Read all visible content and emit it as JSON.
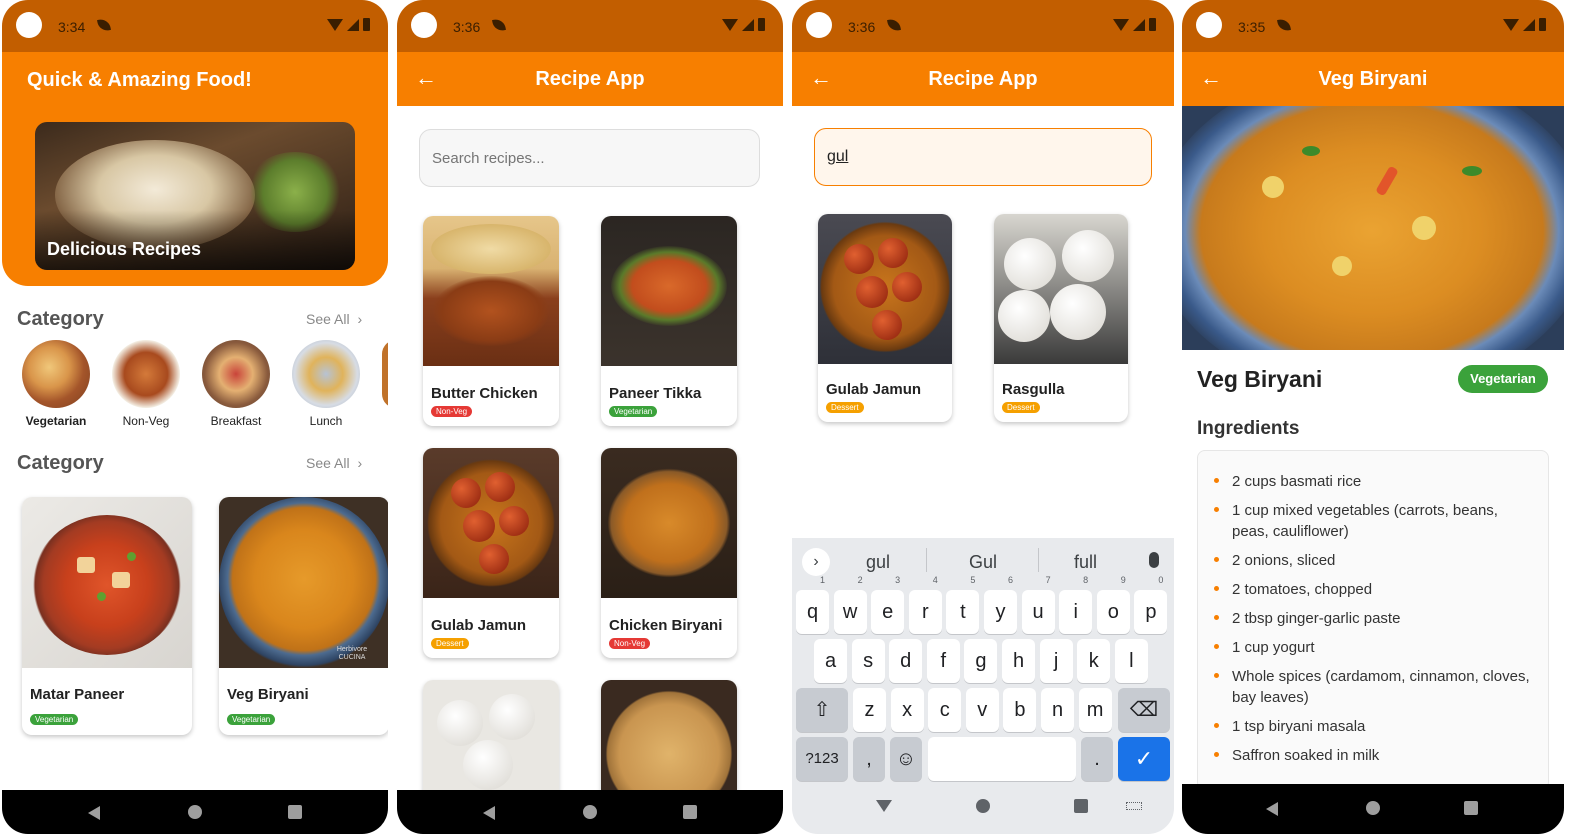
{
  "screens": [
    {
      "status_time": "3:34",
      "header_title": "Quick & Amazing Food!",
      "hero_label": "Delicious Recipes",
      "section1_title": "Category",
      "section1_see_all": "See All",
      "categories": [
        "Vegetarian",
        "Non-Veg",
        "Breakfast",
        "Lunch"
      ],
      "section2_title": "Category",
      "section2_see_all": "See All",
      "recipes": [
        {
          "name": "Matar Paneer",
          "tag": "Vegetarian"
        },
        {
          "name": "Veg Biryani",
          "tag": "Vegetarian"
        }
      ],
      "watermark": "Herbivore CUCINA"
    },
    {
      "status_time": "3:36",
      "title": "Recipe App",
      "search_placeholder": "Search recipes...",
      "recipes": [
        {
          "name": "Butter Chicken",
          "tag": "Non-Veg"
        },
        {
          "name": "Paneer Tikka",
          "tag": "Vegetarian"
        },
        {
          "name": "Gulab Jamun",
          "tag": "Dessert"
        },
        {
          "name": "Chicken Biryani",
          "tag": "Non-Veg"
        }
      ]
    },
    {
      "status_time": "3:36",
      "title": "Recipe App",
      "search_value": "gul",
      "recipes": [
        {
          "name": "Gulab Jamun",
          "tag": "Dessert"
        },
        {
          "name": "Rasgulla",
          "tag": "Dessert"
        }
      ],
      "keyboard": {
        "suggestions": [
          "gul",
          "Gul",
          "full"
        ],
        "row1": [
          "q",
          "w",
          "e",
          "r",
          "t",
          "y",
          "u",
          "i",
          "o",
          "p"
        ],
        "row1_hints": [
          "1",
          "2",
          "3",
          "4",
          "5",
          "6",
          "7",
          "8",
          "9",
          "0"
        ],
        "row2": [
          "a",
          "s",
          "d",
          "f",
          "g",
          "h",
          "j",
          "k",
          "l"
        ],
        "row3": [
          "z",
          "x",
          "c",
          "v",
          "b",
          "n",
          "m"
        ],
        "symbols_key": "?123",
        "comma_key": ",",
        "period_key": "."
      }
    },
    {
      "status_time": "3:35",
      "title": "Veg Biryani",
      "recipe_name": "Veg Biryani",
      "badge": "Vegetarian",
      "ingredients_title": "Ingredients",
      "ingredients": [
        "2 cups basmati rice",
        "1 cup mixed vegetables (carrots, beans, peas, cauliflower)",
        "2 onions, sliced",
        "2 tomatoes, chopped",
        "2 tbsp ginger-garlic paste",
        "1 cup yogurt",
        "Whole spices (cardamom, cinnamon, cloves, bay leaves)",
        "1 tsp biryani masala",
        "Saffron soaked in milk"
      ]
    }
  ],
  "colors": {
    "primary": "#f77f00",
    "status_bar": "#c25e00",
    "veg": "#3ba23b",
    "nonveg": "#e53935",
    "dessert": "#f5a000",
    "keyboard_action": "#1a73e8"
  }
}
